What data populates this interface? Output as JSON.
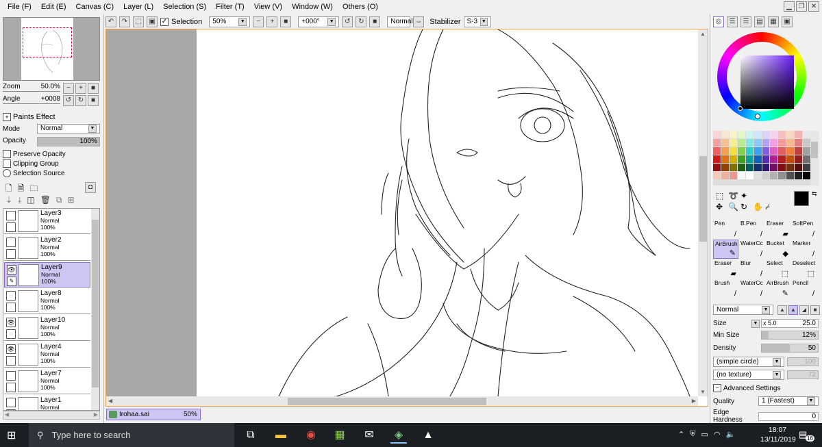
{
  "menu": [
    "File (F)",
    "Edit (E)",
    "Canvas (C)",
    "Layer (L)",
    "Selection (S)",
    "Filter (T)",
    "View (V)",
    "Window (W)",
    "Others (O)"
  ],
  "toolbar": {
    "selection_label": "Selection",
    "zoom_value": "50%",
    "angle_value": "+000°",
    "blend_value": "Normal",
    "stabilizer_label": "Stabilizer",
    "stabilizer_value": "S-3"
  },
  "navigator": {
    "zoom_label": "Zoom",
    "zoom_value": "50.0%",
    "angle_label": "Angle",
    "angle_value": "+0008"
  },
  "layer_props": {
    "paints_effect": "Paints Effect",
    "mode_label": "Mode",
    "mode_value": "Normal",
    "opacity_label": "Opacity",
    "opacity_value": "100%",
    "opacity_fraction": 1.0,
    "preserve_opacity": "Preserve Opacity",
    "clipping_group": "Clipping Group",
    "selection_source": "Selection Source"
  },
  "layers": [
    {
      "name": "Layer3",
      "mode": "Normal",
      "opacity": "100%",
      "visible": false,
      "selected": false
    },
    {
      "name": "Layer2",
      "mode": "Normal",
      "opacity": "100%",
      "visible": false,
      "selected": false
    },
    {
      "name": "Layer9",
      "mode": "Normal",
      "opacity": "100%",
      "visible": true,
      "selected": true
    },
    {
      "name": "Layer8",
      "mode": "Normal",
      "opacity": "100%",
      "visible": false,
      "selected": false
    },
    {
      "name": "Layer10",
      "mode": "Normal",
      "opacity": "100%",
      "visible": true,
      "selected": false
    },
    {
      "name": "Layer4",
      "mode": "Normal",
      "opacity": "100%",
      "visible": true,
      "selected": false
    },
    {
      "name": "Layer7",
      "mode": "Normal",
      "opacity": "100%",
      "visible": false,
      "selected": false
    },
    {
      "name": "Layer1",
      "mode": "Normal",
      "opacity": "",
      "visible": false,
      "selected": false
    }
  ],
  "file_tab": {
    "name": "Irohaa.sai",
    "zoom": "50%"
  },
  "tools": [
    {
      "label": "Pen",
      "icon": "/"
    },
    {
      "label": "B.Pen",
      "icon": "/"
    },
    {
      "label": "Eraser",
      "icon": "▰"
    },
    {
      "label": "SoftPen",
      "icon": "/"
    },
    {
      "label": "AirBrush",
      "icon": "✎",
      "selected": true
    },
    {
      "label": "WaterCc",
      "icon": "/"
    },
    {
      "label": "Bucket",
      "icon": "◆"
    },
    {
      "label": "Marker",
      "icon": "/"
    },
    {
      "label": "Eraser",
      "icon": "▰"
    },
    {
      "label": "Blur",
      "icon": "/"
    },
    {
      "label": "Select",
      "icon": "⬚"
    },
    {
      "label": "Deselect",
      "icon": "⬚"
    },
    {
      "label": "Brush",
      "icon": "/"
    },
    {
      "label": "WaterCc",
      "icon": "/"
    },
    {
      "label": "AirBrush",
      "icon": "✎"
    },
    {
      "label": "Pencil",
      "icon": "/"
    }
  ],
  "brush": {
    "blend": "Normal",
    "size_label": "Size",
    "size_mult": "x 5.0",
    "size_value": "25.0",
    "minsize_label": "Min Size",
    "minsize_value": "12%",
    "minsize_fraction": 0.12,
    "density_label": "Density",
    "density_value": "50",
    "density_fraction": 0.5,
    "shape": "(simple circle)",
    "shape_value": "100",
    "texture": "(no texture)",
    "texture_value": "72",
    "advanced": "Advanced Settings",
    "quality_label": "Quality",
    "quality_value": "1 (Fastest)",
    "edge_label": "Edge Hardness",
    "edge_value": "0"
  },
  "colors": {
    "accent": "#8a6fd0",
    "selected_bg": "#ccc6f2",
    "primary_color": "#000000",
    "canvas_border": "#f0a040"
  },
  "swatches": [
    "#f9d6d6",
    "#f9e6d0",
    "#f9f4c8",
    "#e3f6c8",
    "#c8f4f2",
    "#cfe6fb",
    "#dbd3f8",
    "#f6d3ef",
    "#f5c0c0",
    "#f8d8c0",
    "#f1b3b3",
    "#e8e8e8",
    "#f5a0a0",
    "#f8c090",
    "#f5ef8f",
    "#b8eb8f",
    "#80e8e3",
    "#8fc7f5",
    "#b3a1f2",
    "#f0a0e0",
    "#f39b9b",
    "#f5b98f",
    "#e08080",
    "#c8c8c8",
    "#f06060",
    "#f5a050",
    "#f0e040",
    "#80d050",
    "#30d0c8",
    "#40a0f0",
    "#8060e0",
    "#e060c0",
    "#e06060",
    "#f08040",
    "#c04040",
    "#a0a0a0",
    "#d01818",
    "#e07010",
    "#d0b000",
    "#40a020",
    "#00a098",
    "#1060c0",
    "#5030b0",
    "#b02090",
    "#b02020",
    "#c05010",
    "#902020",
    "#707070",
    "#901010",
    "#904000",
    "#807000",
    "#206010",
    "#006060",
    "#103070",
    "#301870",
    "#701060",
    "#801010",
    "#703010",
    "#501010",
    "#404040",
    "#f6c8b8",
    "#f0b0a0",
    "#e89890",
    "#f8f8f8",
    "#ffffff",
    "#e0e0e0",
    "#d0d0d0",
    "#b0b0b0",
    "#909090",
    "#505050",
    "#202020",
    "#000000"
  ],
  "taskbar": {
    "search_placeholder": "Type here to search",
    "time": "18:07",
    "date": "13/11/2019",
    "notifications": "16"
  }
}
